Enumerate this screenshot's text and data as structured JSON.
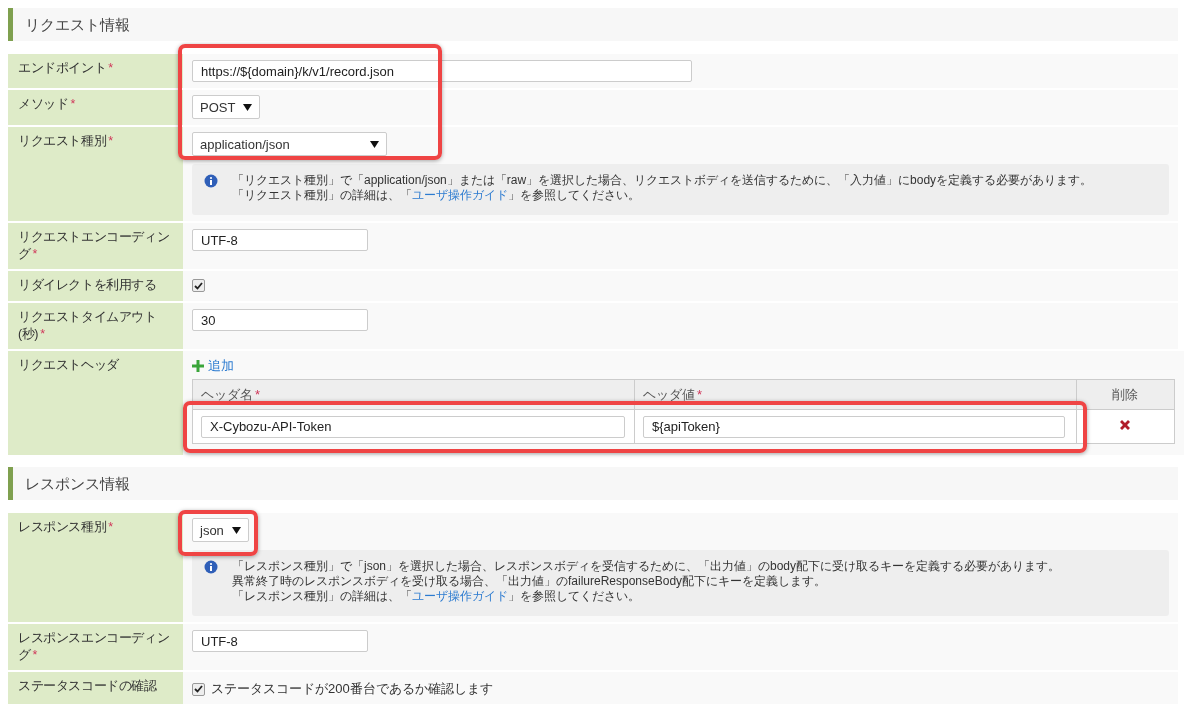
{
  "sections": [
    {
      "title": "リクエスト情報",
      "rows": [
        {
          "kind": "long-text",
          "label": "エンドポイント",
          "mark": "*",
          "value": "https://${domain}/k/v1/record.json"
        },
        {
          "kind": "select",
          "label": "メソッド",
          "mark": "*",
          "value": "POST"
        },
        {
          "kind": "select",
          "label": "リクエスト種別",
          "mark": "*",
          "value": "application/json",
          "note": [
            {
              "before": "「リクエスト種別」で「application/json」または「raw」を選択した場合、リクエストボディを送信するために、「入力値」にbodyを定義する必要があります。"
            },
            {
              "before": "「リクエスト種別」の詳細は、「",
              "link": "ユーザ操作ガイド",
              "after": "」を参照してください。"
            }
          ]
        },
        {
          "kind": "text",
          "label": "リクエストエンコーディング",
          "mark": "*",
          "value": "UTF-8"
        },
        {
          "kind": "checkbox",
          "label": "リダイレクトを利用する",
          "checked": true
        },
        {
          "kind": "text",
          "label": "リクエストタイムアウト(秒)",
          "mark": "*",
          "value": "30"
        },
        {
          "kind": "headers",
          "label": "リクエストヘッダ",
          "add": "追加",
          "columns": [
            {
              "label": "ヘッダ名",
              "mark": "*"
            },
            {
              "label": "ヘッダ値",
              "mark": "*"
            },
            {
              "label": "削除"
            }
          ],
          "items": [
            {
              "name": "X-Cybozu-API-Token",
              "value": "${apiToken}"
            }
          ]
        }
      ]
    },
    {
      "title": "レスポンス情報",
      "rows": [
        {
          "kind": "select",
          "label": "レスポンス種別",
          "mark": "*",
          "value": "json",
          "note": [
            {
              "before": "「レスポンス種別」で「json」を選択した場合、レスポンスボディを受信するために、「出力値」のbody配下に受け取るキーを定義する必要があります。"
            },
            {
              "before": "異常終了時のレスポンスボディを受け取る場合、「出力値」のfailureResponseBody配下にキーを定義します。"
            },
            {
              "before": "「レスポンス種別」の詳細は、「",
              "link": "ユーザ操作ガイド",
              "after": "」を参照してください。"
            }
          ]
        },
        {
          "kind": "text",
          "label": "レスポンスエンコーディング",
          "mark": "*",
          "value": "UTF-8"
        },
        {
          "kind": "checkbox",
          "label": "ステータスコードの確認",
          "checked": true,
          "text": "ステータスコードが200番台であるか確認します"
        }
      ]
    }
  ]
}
